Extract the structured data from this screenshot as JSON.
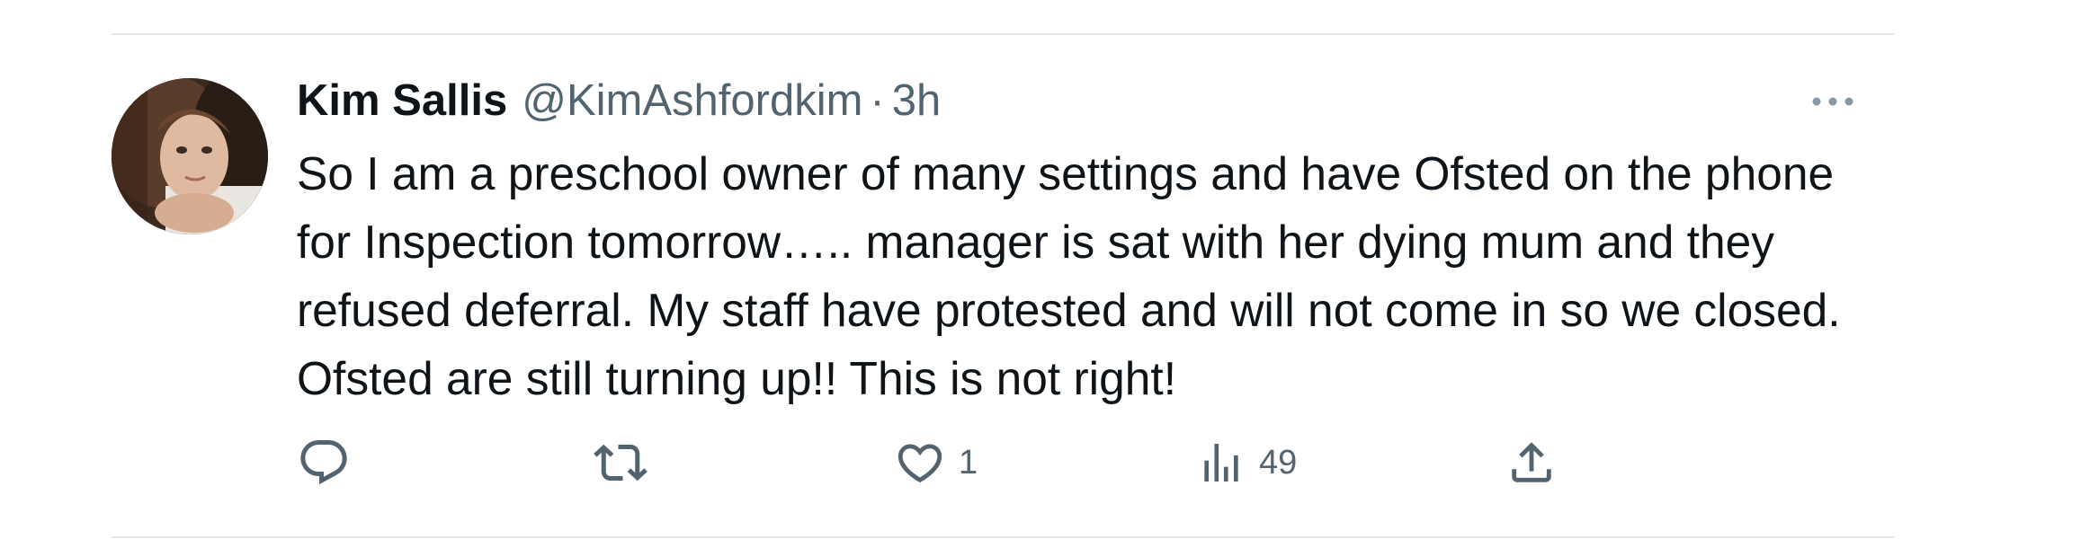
{
  "tweet": {
    "author": {
      "display_name": "Kim Sallis",
      "handle": "@KimAshfordkim"
    },
    "separator": "·",
    "time": "3h",
    "text": "So I am a preschool owner of many settings and have Ofsted on the phone for Inspection tomorrow….. manager is sat with her dying mum and they refused deferral. My staff have protested and will not come in so we closed. Ofsted are still turning up!! This is not right!",
    "actions": {
      "reply": {
        "icon": "reply-icon"
      },
      "retweet": {
        "icon": "retweet-icon"
      },
      "like": {
        "icon": "heart-icon",
        "count": "1"
      },
      "views": {
        "icon": "views-icon",
        "count": "49"
      },
      "share": {
        "icon": "share-icon"
      }
    }
  },
  "colors": {
    "text_primary": "#0f1419",
    "text_secondary": "#536471",
    "divider": "#e6e6e6"
  }
}
